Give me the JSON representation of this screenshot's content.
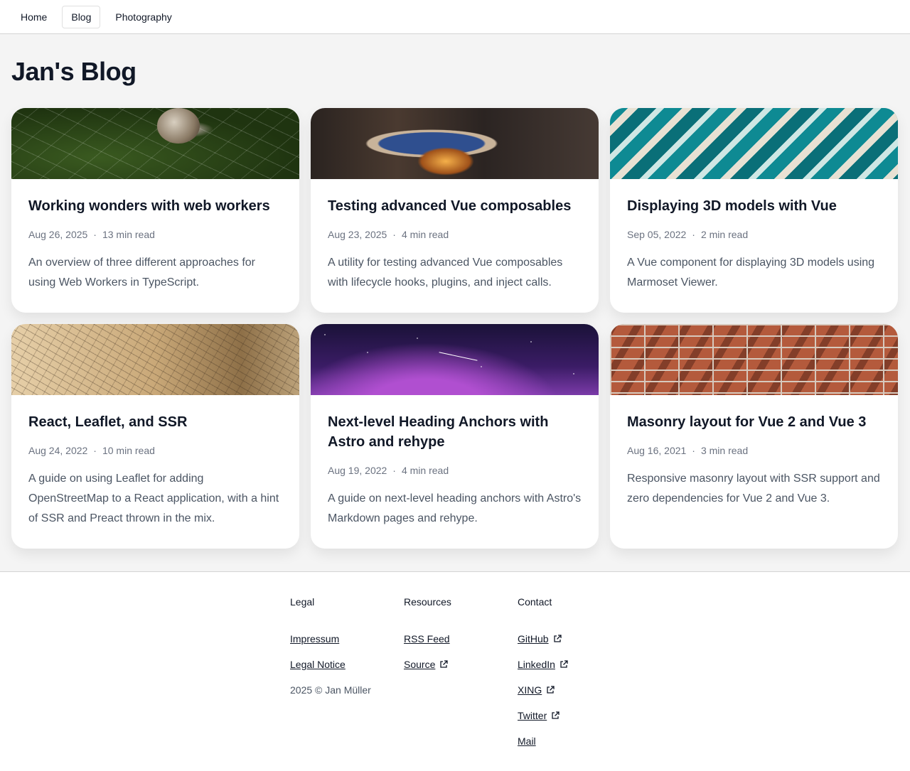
{
  "nav": {
    "items": [
      {
        "label": "Home",
        "active": false
      },
      {
        "label": "Blog",
        "active": true
      },
      {
        "label": "Photography",
        "active": false
      }
    ]
  },
  "page": {
    "title": "Jan's Blog"
  },
  "posts": [
    {
      "title": "Working wonders with web workers",
      "date": "Aug 26, 2025",
      "read": "13 min read",
      "description": "An overview of three different approaches for using Web Workers in TypeScript.",
      "image": "spider-web-photo"
    },
    {
      "title": "Testing advanced Vue composables",
      "date": "Aug 23, 2025",
      "read": "4 min read",
      "description": "A utility for testing advanced Vue composables with lifecycle hooks, plugins, and inject calls.",
      "image": "porthole-machinery-photo"
    },
    {
      "title": "Displaying 3D models with Vue",
      "date": "Sep 05, 2022",
      "read": "2 min read",
      "description": "A Vue component for displaying 3D models using Marmoset Viewer.",
      "image": "fluid-art-photo"
    },
    {
      "title": "React, Leaflet, and SSR",
      "date": "Aug 24, 2022",
      "read": "10 min read",
      "description": "A guide on using Leaflet for adding OpenStreetMap to a React application, with a hint of SSR and Preact thrown in the mix.",
      "image": "old-map-photo"
    },
    {
      "title": "Next-level Heading Anchors with Astro and rehype",
      "date": "Aug 19, 2022",
      "read": "4 min read",
      "description": "A guide on next-level heading anchors with Astro's Markdown pages and rehype.",
      "image": "night-sky-photo"
    },
    {
      "title": "Masonry layout for Vue 2 and Vue 3",
      "date": "Aug 16, 2021",
      "read": "3 min read",
      "description": "Responsive masonry layout with SSR support and zero dependencies for Vue 2 and Vue 3.",
      "image": "brick-wall-photo"
    }
  ],
  "meta_separator": "·",
  "footer": {
    "legal": {
      "heading": "Legal",
      "links": [
        "Impressum",
        "Legal Notice"
      ],
      "copyright": "2025 © Jan Müller"
    },
    "resources": {
      "heading": "Resources",
      "links": [
        "RSS Feed",
        "Source"
      ]
    },
    "contact": {
      "heading": "Contact",
      "links": [
        "GitHub",
        "LinkedIn",
        "XING",
        "Twitter",
        "Mail"
      ]
    }
  }
}
